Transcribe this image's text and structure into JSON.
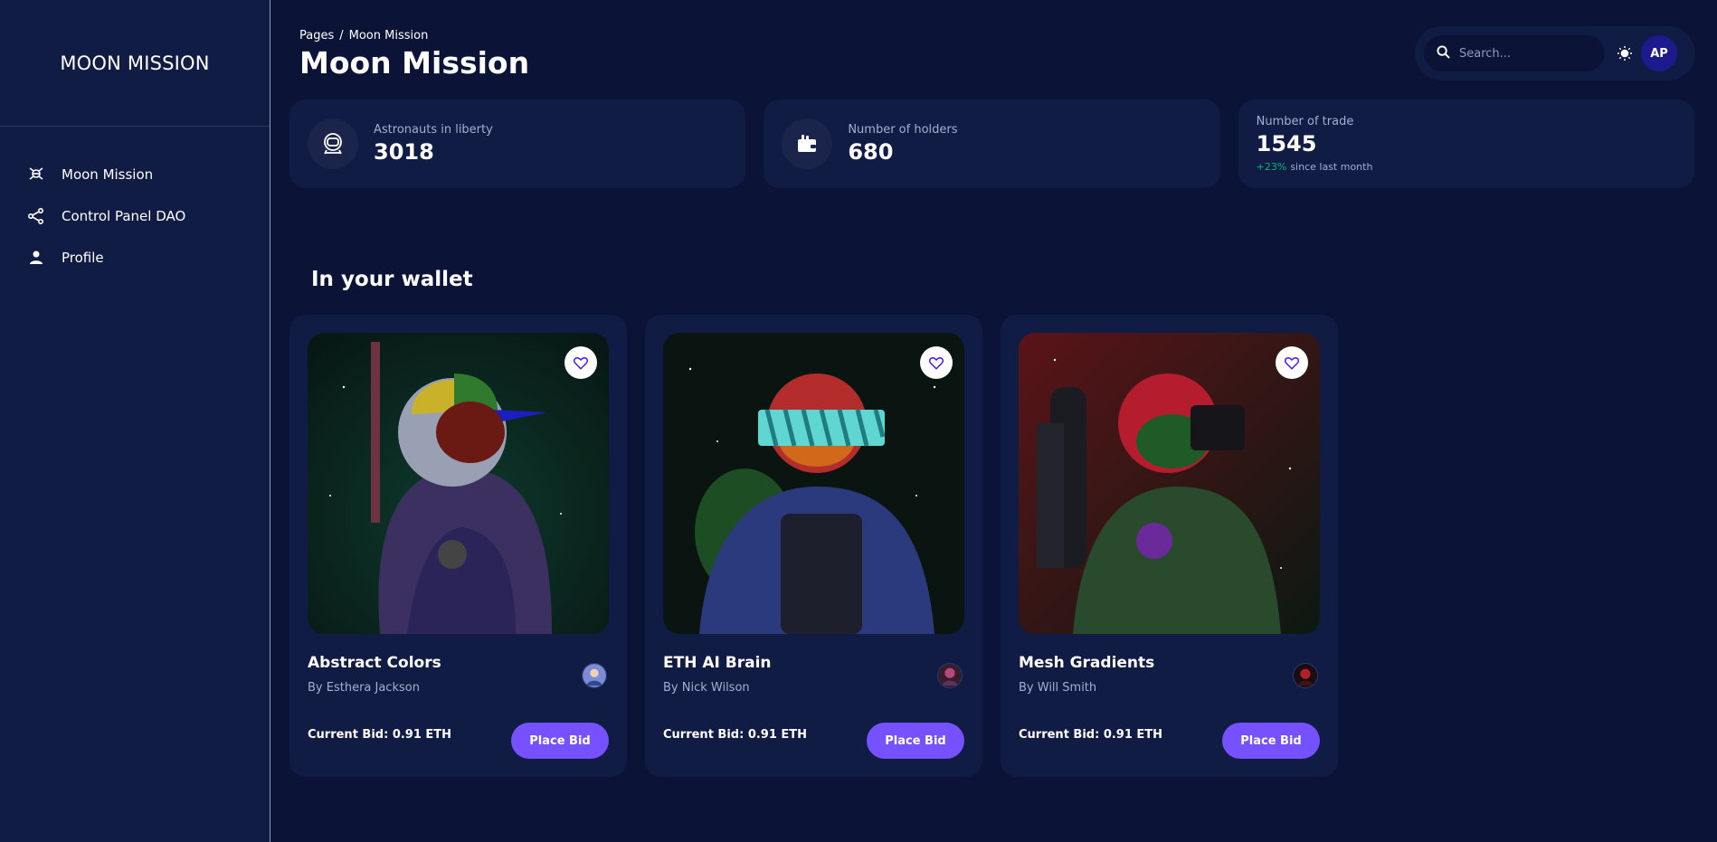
{
  "brand": "MOON MISSION",
  "sidebar": {
    "items": [
      {
        "label": "Moon Mission",
        "icon": "astronaut-icon"
      },
      {
        "label": "Control Panel DAO",
        "icon": "share-icon"
      },
      {
        "label": "Profile",
        "icon": "person-icon"
      }
    ]
  },
  "header": {
    "breadcrumb_root": "Pages",
    "breadcrumb_separator": "/",
    "breadcrumb_current": "Moon Mission",
    "title": "Moon Mission"
  },
  "topbar": {
    "search_placeholder": "Search...",
    "avatar_initials": "AP"
  },
  "stats": [
    {
      "label": "Astronauts in liberty",
      "value": "3018",
      "icon": "astronaut-helmet-icon"
    },
    {
      "label": "Number of holders",
      "value": "680",
      "icon": "wallet-icon"
    },
    {
      "label": "Number of trade",
      "value": "1545",
      "change": "+23%",
      "change_suffix": "since last month"
    }
  ],
  "section_title": "In your wallet",
  "nfts": [
    {
      "title": "Abstract Colors",
      "author": "By Esthera Jackson",
      "bid": "Current Bid: 0.91 ETH",
      "button": "Place Bid"
    },
    {
      "title": "ETH AI Brain",
      "author": "By Nick Wilson",
      "bid": "Current Bid: 0.91 ETH",
      "button": "Place Bid"
    },
    {
      "title": "Mesh Gradients",
      "author": "By Will Smith",
      "bid": "Current Bid: 0.91 ETH",
      "button": "Place Bid"
    }
  ],
  "colors": {
    "background": "#0b1437",
    "card": "#111c44",
    "accent": "#7551ff",
    "positive": "#01b574",
    "muted_text": "#a3aed0"
  }
}
